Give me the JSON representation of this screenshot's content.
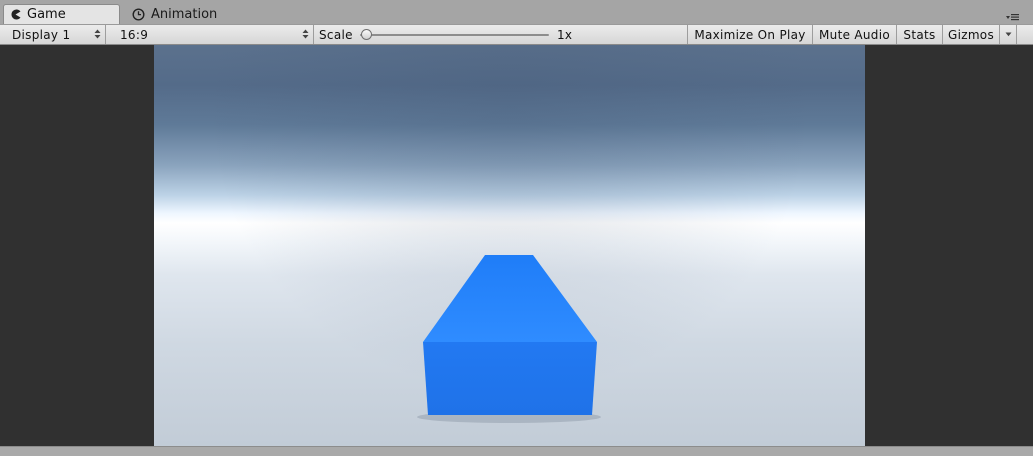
{
  "tabs": [
    {
      "label": "Game",
      "icon": "pacman-game-icon"
    },
    {
      "label": "Animation",
      "icon": "clock-icon"
    }
  ],
  "toolbar": {
    "display": "Display 1",
    "aspect": "16:9",
    "scale_label": "Scale",
    "scale_value": "1x",
    "scale_slider_level": 0,
    "maximize_on_play": "Maximize On Play",
    "mute_audio": "Mute Audio",
    "stats": "Stats",
    "gizmos": "Gizmos"
  },
  "scene": {
    "cube_color": "#2178f0",
    "cube_top_color": "#2b87ff",
    "sky_color": "#546b89",
    "horizon_color": "#ffffff",
    "ground_color": "#c8d1db"
  },
  "colors": {
    "background_dark": "#303030",
    "toolbar_bg": "#dcdcdc"
  }
}
